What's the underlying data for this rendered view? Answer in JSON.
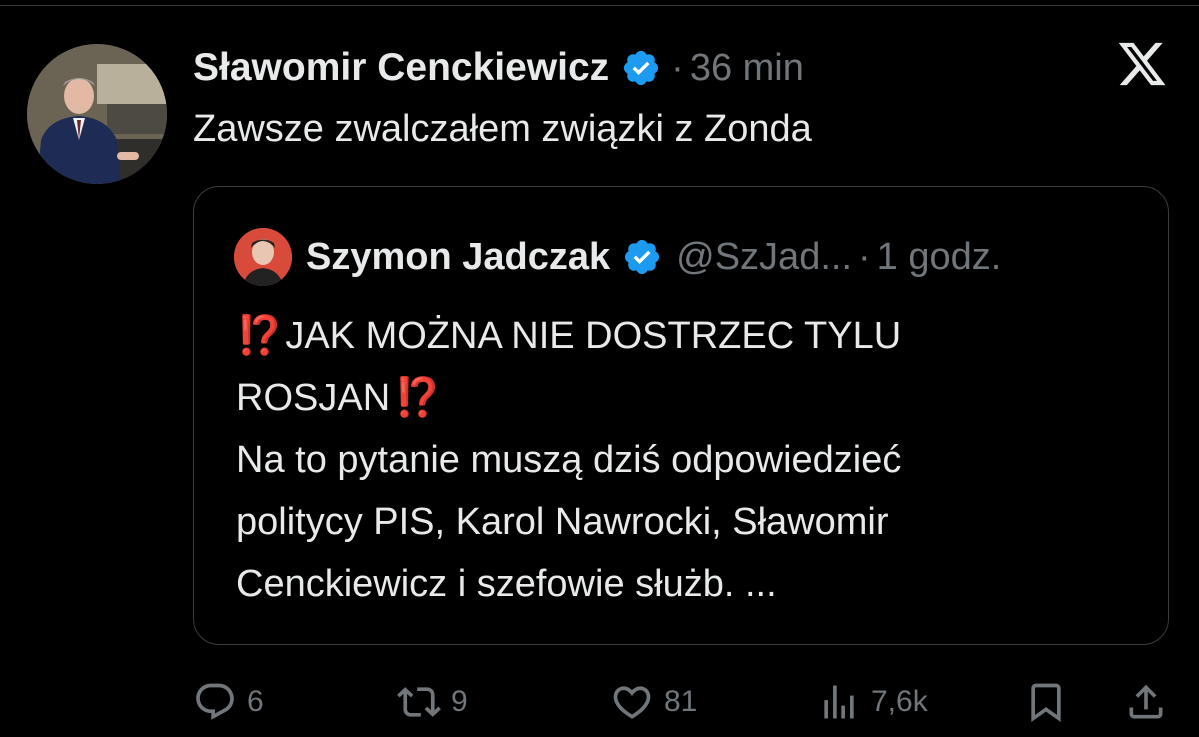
{
  "post": {
    "author_name": "Sławomir Cenckiewicz",
    "separator": "·",
    "time": "36 min",
    "text": "Zawsze zwalczałem związki z Zonda"
  },
  "quoted": {
    "author_name": "Szymon Jadczak",
    "handle": "@SzJad...",
    "separator": "·",
    "time": "1 godz.",
    "emoji": "⁉️",
    "line1": "JAK MOŻNA NIE DOSTRZEC TYLU",
    "line2": "ROSJAN",
    "line3": "Na to pytanie muszą dziś odpowiedzieć",
    "line4": "politycy PIS, Karol Nawrocki, Sławomir",
    "line5": "Cenckiewicz i szefowie służb. ..."
  },
  "actions": {
    "replies": "6",
    "reposts": "9",
    "likes": "81",
    "views": "7,6k"
  },
  "icons": {
    "brand": "x-logo-icon",
    "verified": "verified-badge-icon",
    "reply": "reply-icon",
    "repost": "repost-icon",
    "like": "heart-icon",
    "views": "views-icon",
    "bookmark": "bookmark-icon",
    "share": "share-icon"
  },
  "colors": {
    "background": "#000000",
    "text": "#e7e9ea",
    "muted": "#71767b",
    "verified": "#1d9bf0",
    "emoji": "#e2382b"
  }
}
